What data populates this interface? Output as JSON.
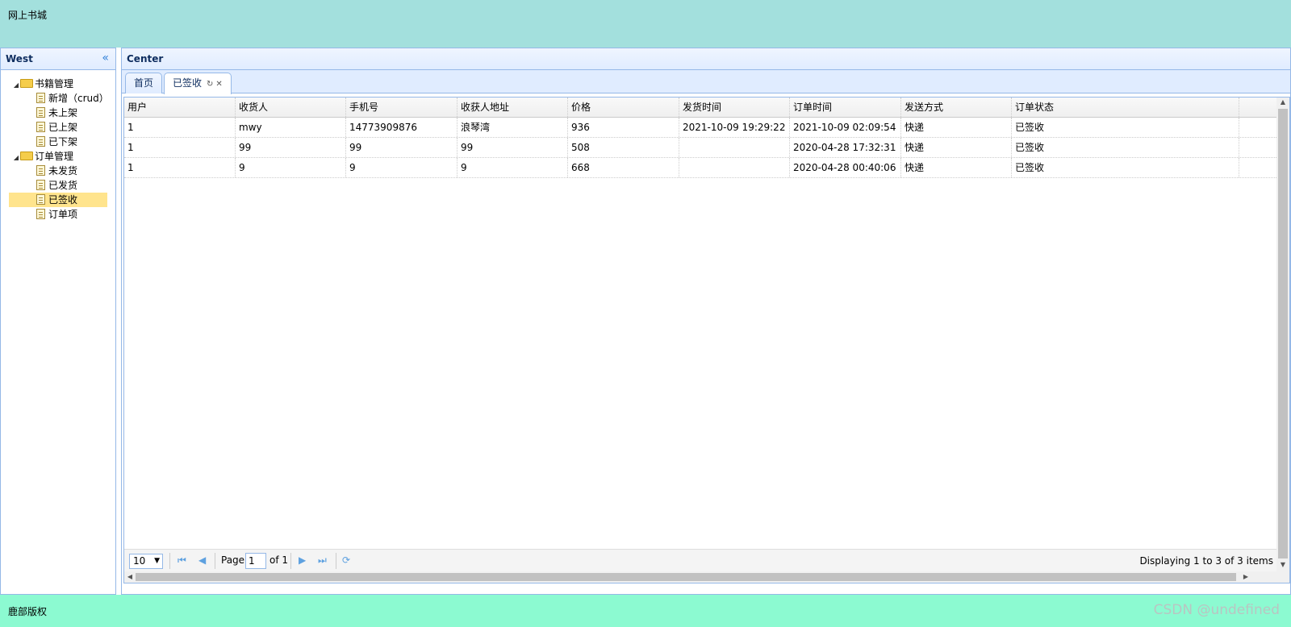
{
  "header": {
    "title": "网上书城"
  },
  "footer": {
    "text": "鹿部版权",
    "watermark": "CSDN @undefined"
  },
  "west": {
    "title": "West",
    "tree": [
      {
        "label": "书籍管理",
        "type": "folder",
        "expanded": true
      },
      {
        "label": "新增（crud）",
        "type": "file"
      },
      {
        "label": "未上架",
        "type": "file"
      },
      {
        "label": "已上架",
        "type": "file"
      },
      {
        "label": "已下架",
        "type": "file"
      },
      {
        "label": "订单管理",
        "type": "folder",
        "expanded": true
      },
      {
        "label": "未发货",
        "type": "file"
      },
      {
        "label": "已发货",
        "type": "file"
      },
      {
        "label": "已签收",
        "type": "file",
        "selected": true
      },
      {
        "label": "订单项",
        "type": "file"
      }
    ]
  },
  "center": {
    "title": "Center",
    "tabs": [
      {
        "label": "首页",
        "active": false
      },
      {
        "label": "已签收",
        "active": true
      }
    ]
  },
  "grid": {
    "columns": [
      "用户",
      "收货人",
      "手机号",
      "收获人地址",
      "价格",
      "发货时间",
      "订单时间",
      "发送方式",
      "订单状态"
    ],
    "rows": [
      [
        "1",
        "mwy",
        "14773909876",
        "浪琴湾",
        "936",
        "2021-10-09 19:29:22",
        "2021-10-09 02:09:54",
        "快递",
        "已签收"
      ],
      [
        "1",
        "99",
        "99",
        "99",
        "508",
        "",
        "2020-04-28 17:32:31",
        "快递",
        "已签收"
      ],
      [
        "1",
        "9",
        "9",
        "9",
        "668",
        "",
        "2020-04-28 00:40:06",
        "快递",
        "已签收"
      ]
    ]
  },
  "pager": {
    "page_size": "10",
    "page_label": "Page",
    "page_value": "1",
    "of_label": "of 1",
    "info": "Displaying 1 to 3 of 3 items"
  },
  "colors": {
    "north": "#a3e0dd",
    "south": "#8cfad1",
    "panel_border": "#95b8e7",
    "selected": "#ffe48d"
  }
}
